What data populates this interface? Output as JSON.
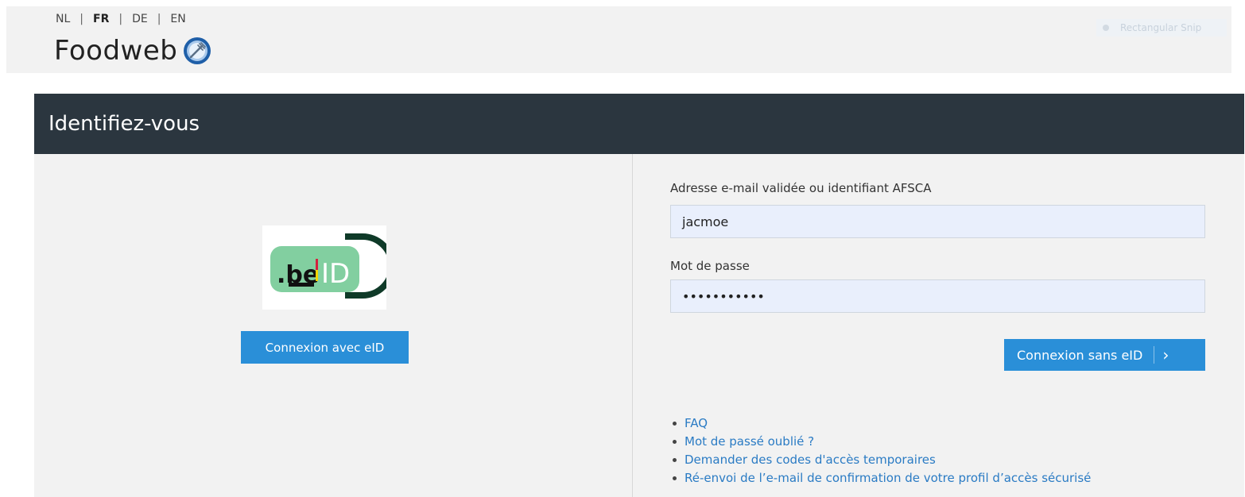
{
  "languages": [
    {
      "code": "NL",
      "active": false
    },
    {
      "code": "FR",
      "active": true
    },
    {
      "code": "DE",
      "active": false
    },
    {
      "code": "EN",
      "active": false
    }
  ],
  "brand": {
    "name": "Foodweb",
    "icon": "fork-globe-icon"
  },
  "skip_link": {
    "label": "Rectangular Snip"
  },
  "panel": {
    "title": "Identifiez-vous"
  },
  "eid": {
    "logo_text_be": ".be",
    "logo_text_id": "ID",
    "button_label": "Connexion avec eID"
  },
  "login": {
    "email_label": "Adresse e-mail validée ou identifiant AFSCA",
    "email_value": "jacmoe",
    "password_label": "Mot de passe",
    "password_value": "•••••••••••",
    "submit_label": "Connexion sans eID",
    "submit_icon": "chevron-right-icon"
  },
  "links": [
    "FAQ",
    "Mot de passé oublié ?",
    "Demander des codes d'accès temporaires",
    "Ré-envoi de l’e-mail de confirmation de votre profil d’accès sécurisé"
  ],
  "colors": {
    "header_bg": "#2b363f",
    "button_blue": "#2a8fd8",
    "link_blue": "#2a7bc4",
    "field_bg": "#e9effc"
  }
}
